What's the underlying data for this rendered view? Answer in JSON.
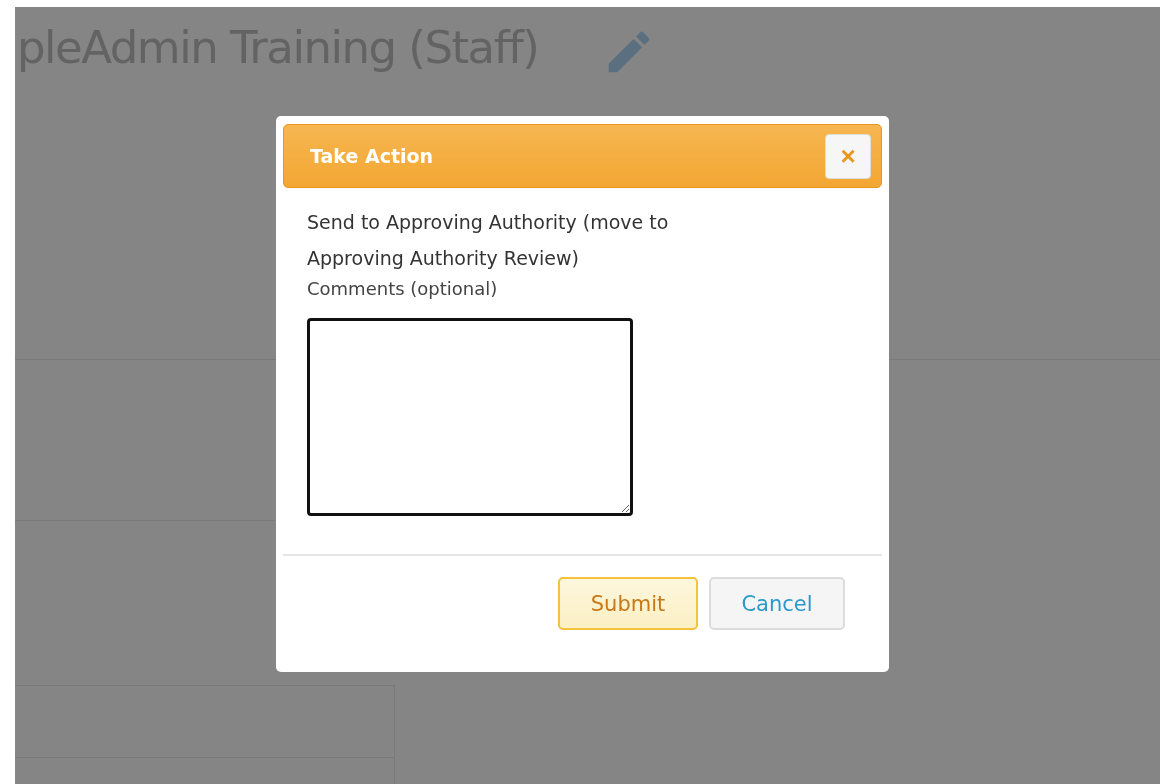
{
  "page": {
    "title": "pleAdmin Training (Staff)"
  },
  "dialog": {
    "title": "Take Action",
    "close_label": "×",
    "action": "Send to Approving Authority (move to Approving Authority Review)",
    "comments_label": "Comments (optional)",
    "buttons": [
      {
        "kind": "primary",
        "label": "Submit"
      },
      {
        "kind": "secondary",
        "label": "Cancel"
      }
    ]
  }
}
